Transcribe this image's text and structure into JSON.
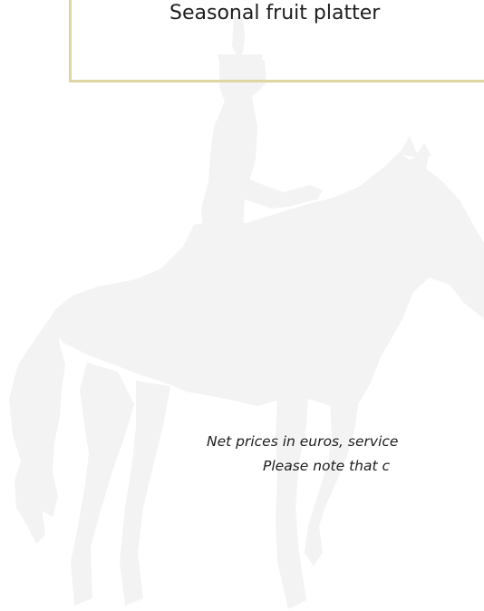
{
  "menu": {
    "item": "Seasonal fruit platter"
  },
  "footer": {
    "note_line1": "Net prices in euros, service",
    "note_line2": "Please note that c"
  },
  "colors": {
    "border_accent": "#ddd6a3",
    "watermark": "#f3f3f3",
    "text": "#1e1e1e"
  },
  "watermark": {
    "icon": "horse-rider-silhouette-icon"
  }
}
